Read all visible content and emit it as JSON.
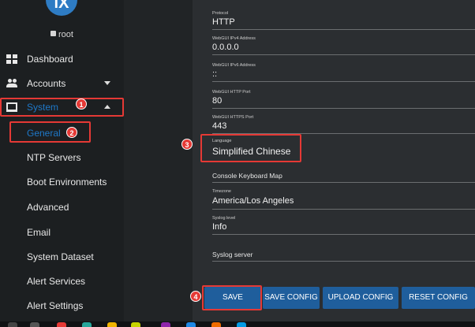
{
  "sidebar": {
    "logo_text": "iX",
    "user": "root",
    "items": [
      {
        "label": "Dashboard",
        "icon": "dashboard-icon"
      },
      {
        "label": "Accounts",
        "icon": "accounts-icon"
      },
      {
        "label": "System",
        "icon": "system-icon"
      }
    ],
    "sub_items": [
      {
        "label": "General"
      },
      {
        "label": "NTP Servers"
      },
      {
        "label": "Boot Environments"
      },
      {
        "label": "Advanced"
      },
      {
        "label": "Email"
      },
      {
        "label": "System Dataset"
      },
      {
        "label": "Alert Services"
      },
      {
        "label": "Alert Settings"
      }
    ]
  },
  "form": {
    "fields": [
      {
        "label": "Protocol",
        "value": "HTTP"
      },
      {
        "label": "WebGUI IPv4 Address",
        "value": "0.0.0.0"
      },
      {
        "label": "WebGUI IPv6 Address",
        "value": "::"
      },
      {
        "label": "WebGUI HTTP Port",
        "value": "80"
      },
      {
        "label": "WebGUI HTTPS Port",
        "value": "443"
      },
      {
        "label": "Language",
        "value": "Simplified Chinese"
      },
      {
        "label": "",
        "value": "Console Keyboard Map"
      },
      {
        "label": "Timezone",
        "value": "America/Los Angeles"
      },
      {
        "label": "Syslog level",
        "value": "Info"
      },
      {
        "label": "",
        "value": "Syslog server"
      }
    ]
  },
  "buttons": {
    "save": "SAVE",
    "save_config": "SAVE CONFIG",
    "upload_config": "UPLOAD CONFIG",
    "reset_config": "RESET CONFIG"
  },
  "annotations": [
    "1",
    "2",
    "3",
    "4"
  ],
  "colors": {
    "accent": "#1e78c8",
    "button": "#1f5e9c",
    "annotation_red": "#e53935",
    "sidebar_bg": "#1c1f21",
    "panel_bg": "#2b2e31"
  }
}
